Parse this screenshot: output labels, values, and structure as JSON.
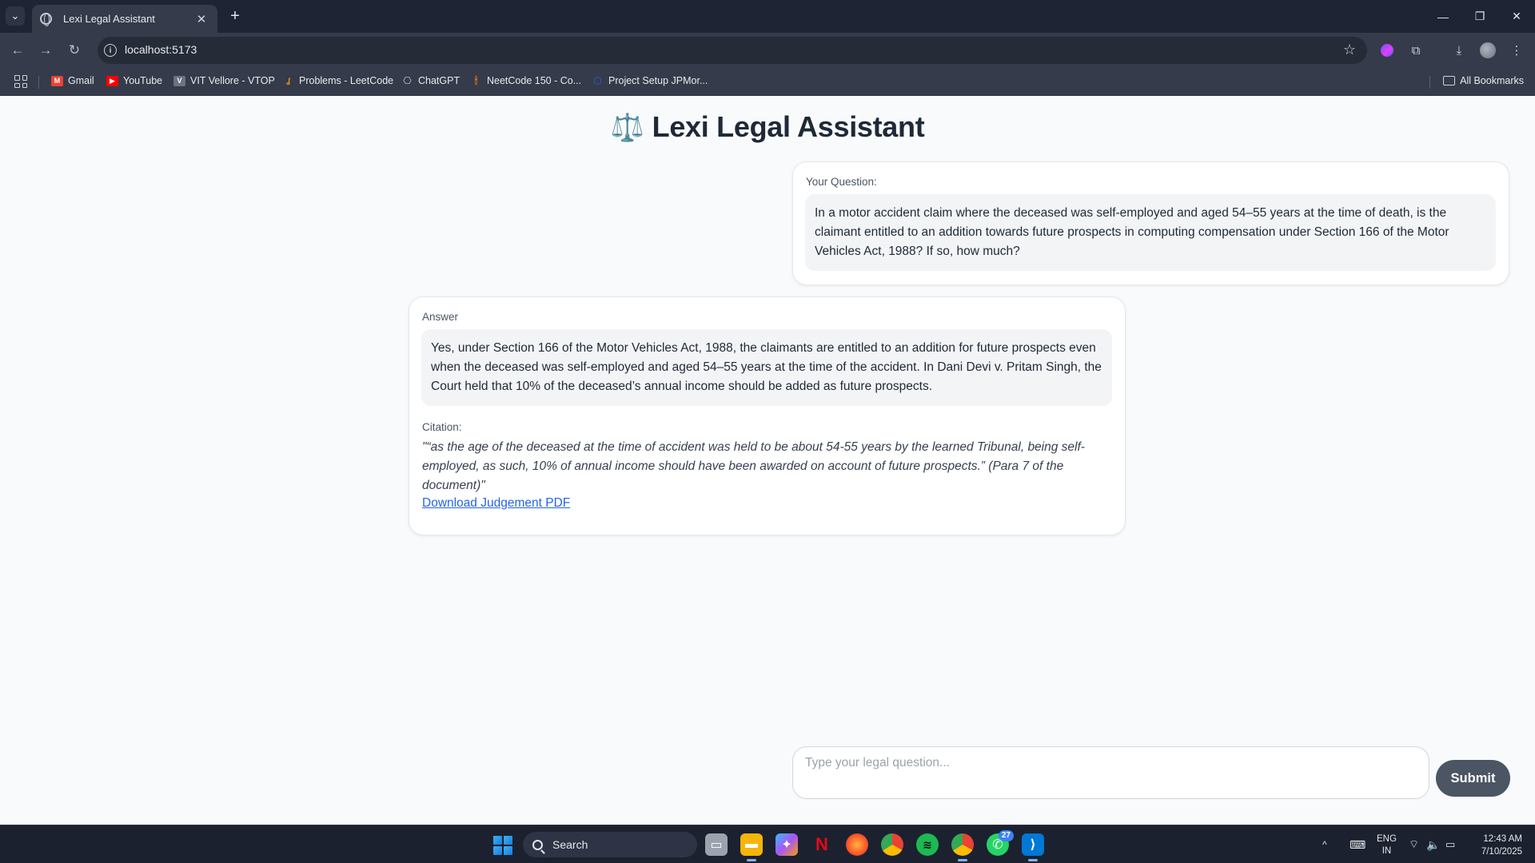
{
  "browser": {
    "tab_title": "Lexi Legal Assistant",
    "url": "localhost:5173",
    "bookmarks": [
      {
        "label": "Gmail",
        "icon": "gmail-icon",
        "color": "#ea4335"
      },
      {
        "label": "YouTube",
        "icon": "youtube-icon",
        "color": "#ff0000"
      },
      {
        "label": "VIT Vellore - VTOP",
        "icon": "vtop-icon",
        "color": "#6b7280"
      },
      {
        "label": "Problems - LeetCode",
        "icon": "leetcode-icon",
        "color": "#f59e0b"
      },
      {
        "label": "ChatGPT",
        "icon": "chatgpt-icon",
        "color": "#d1d5db"
      },
      {
        "label": "NeetCode 150 - Co...",
        "icon": "neetcode-icon",
        "color": "#f97316"
      },
      {
        "label": "Project Setup JPMor...",
        "icon": "jpmorgan-icon",
        "color": "#2563eb"
      }
    ],
    "all_bookmarks": "All Bookmarks"
  },
  "app": {
    "title": "Lexi Legal Assistant",
    "title_icon": "⚖️"
  },
  "question": {
    "label": "Your Question:",
    "text": "In a motor accident claim where the deceased was self-employed and aged 54–55 years at the time of death, is the claimant entitled to an addition towards future prospects in computing compensation under Section 166 of the Motor Vehicles Act, 1988? If so, how much?"
  },
  "answer": {
    "label": "Answer",
    "text": "Yes, under Section 166 of the Motor Vehicles Act, 1988, the claimants are entitled to an addition for future prospects even when the deceased was self-employed and aged 54–55 years at the time of the accident. In Dani Devi v. Pritam Singh, the Court held that 10% of the deceased’s annual income should be added as future prospects.",
    "citation_label": "Citation:",
    "citation_text": "\"“as the age of the deceased at the time of accident was held to be about 54-55 years by the learned Tribunal, being self-employed, as such, 10% of annual income should have been awarded on account of future prospects.” (Para 7 of the document)\"",
    "download_link": "Download Judgement PDF"
  },
  "composer": {
    "placeholder": "Type your legal question...",
    "value": "",
    "submit_label": "Submit"
  },
  "taskbar": {
    "search_label": "Search",
    "whatsapp_badge": "27",
    "lang_line1": "ENG",
    "lang_line2": "IN",
    "time": "12:43 AM",
    "date": "7/10/2025"
  },
  "colors": {
    "accent": "#2563eb",
    "submit_bg": "#4b5563",
    "page_bg": "#f9fafb"
  }
}
